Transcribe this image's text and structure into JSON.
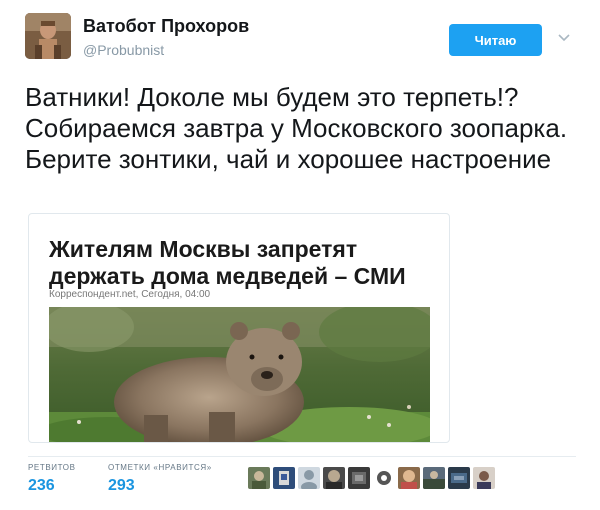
{
  "user": {
    "display_name": "Ватобот Прохоров",
    "screen_name": "@Probubnist",
    "follow_label": "Читаю"
  },
  "tweet": {
    "text": "Ватники! Доколе мы будем это терпеть!? Собираемся завтра у Московского зоопарка. Берите  зонтики, чай и хорошее настроение"
  },
  "card": {
    "title": "Жителям Москвы запретят держать дома медведей – СМИ",
    "source": "Корреспондент.net, Сегодня, 04:00",
    "image_icon": "bear-photo"
  },
  "stats": {
    "retweets_label": "РЕТВИТОВ",
    "retweets_value": "236",
    "likes_label": "ОТМЕТКИ «НРАВИТСЯ»",
    "likes_value": "293"
  },
  "colors": {
    "accent": "#1da1f2",
    "link": "#1b95e0",
    "muted": "#8899a6",
    "border": "#e1e8ed"
  },
  "likers": [
    "liker-1",
    "liker-2",
    "liker-3",
    "liker-4",
    "liker-5",
    "liker-6",
    "liker-7",
    "liker-8",
    "liker-9",
    "liker-10"
  ]
}
